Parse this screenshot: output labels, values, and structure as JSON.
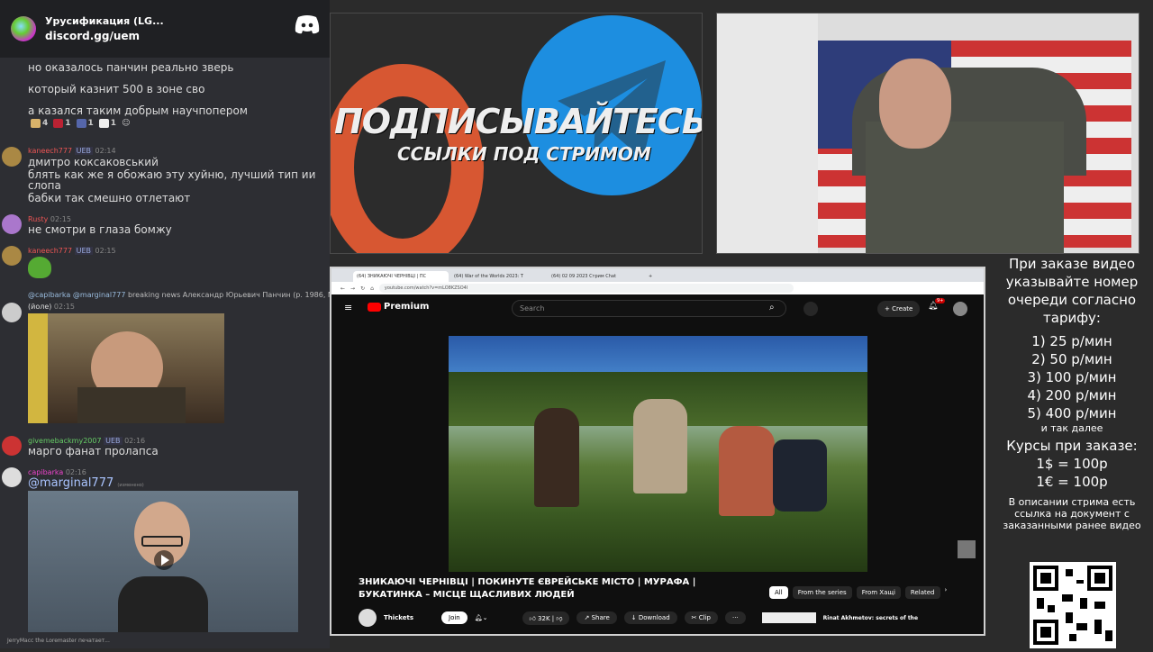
{
  "chat": {
    "server_name": "Урусификация (LG...",
    "server_link": "discord.gg/uem",
    "messages": [
      {
        "text": "но оказалось панчин реально зверь"
      },
      {
        "text": "который казнит 500 в зоне сво"
      },
      {
        "text": "а казался таким добрым научпопером"
      }
    ],
    "reactions": [
      "4",
      "1",
      "1",
      "1"
    ],
    "posts": [
      {
        "author": "kaneech777",
        "badge": "UEB",
        "time": "02:14",
        "lines": [
          "дмитро коксаковський",
          "блять как же я обожаю эту хуйню, лучший тип ии",
          "слопа",
          "бабки так смешно отлетают"
        ]
      },
      {
        "author": "Rusty",
        "time": "02:15",
        "lines": [
          "не смотри в глаза бомжу"
        ]
      },
      {
        "author": "kaneech777",
        "badge": "UEB",
        "time": "02:15",
        "lines": []
      },
      {
        "reply_author": "@capibarka",
        "reply_mention": "@marginal777",
        "reply_text": "breaking news",
        "reply_text2": "Александр Юрьевич Панчин (р. 1986, Москва), ..."
      },
      {
        "author": "(йоле)",
        "time": "02:15",
        "lines": []
      },
      {
        "author": "givemebackmy2007",
        "badge": "UEB",
        "time": "02:16",
        "lines": [
          "марго фанат пролапса"
        ]
      },
      {
        "author": "capibarka",
        "time": "02:16",
        "lines": [
          "@marginal777"
        ],
        "edited": "(изменено)"
      }
    ],
    "typing": "JerryMacc the Loremaster печатает..."
  },
  "promo": {
    "headline": "ПОДПИСЫВАЙТЕСЬ",
    "subline": "ССЫЛКИ ПОД СТРИМОМ"
  },
  "browser": {
    "tabs": [
      {
        "label": "(64) ЗНИКАЮЧІ ЧЕРНІВЦІ | ПС"
      },
      {
        "label": "(64) War of the Worlds 2023: T"
      },
      {
        "label": "(64) 02 09 2023 Стрим Chat"
      }
    ],
    "url": "youtube.com/watch?v=mLO8KZSO4I"
  },
  "youtube": {
    "logo": "Premium",
    "search_placeholder": "Search",
    "create_label": "Create",
    "notif_count": "9+",
    "video_title": "ЗНИКАЮЧІ ЧЕРНІВЦІ | ПОКИНУТЕ ЄВРЕЙСЬКЕ МІСТО | МУРАФА | БУКАТИНКА – МІСЦЕ ЩАСЛИВИХ ЛЮДЕЙ",
    "channel": "Thickets",
    "join": "Join",
    "likes": "32K",
    "share": "Share",
    "download": "Download",
    "clip": "Clip",
    "chips": [
      "All",
      "From the series",
      "From Хащі",
      "Related"
    ],
    "related_title": "Rinat Akhmetov: secrets of the"
  },
  "info": {
    "intro": "При заказе видео указывайте номер очереди согласно тарифу:",
    "tariffs": [
      "1) 25 р/мин",
      "2) 50 р/мин",
      "3) 100 р/мин",
      "4) 200 р/мин",
      "5) 400 р/мин"
    ],
    "and_more": "и так далее",
    "rates_title": "Курсы при заказе:",
    "rates": [
      "1$ = 100р",
      "1€ = 100р"
    ],
    "note": "В описании стрима есть ссылка на документ с заказанными ранее видео"
  }
}
